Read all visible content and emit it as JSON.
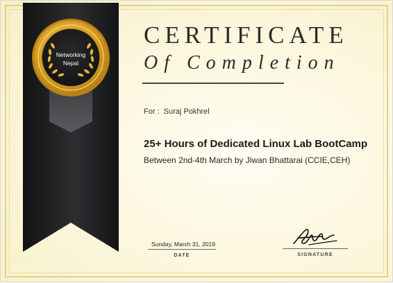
{
  "certificate": {
    "title": "CERTIFICATE",
    "subtitle": "Of Completion",
    "recipient_label": "For :",
    "recipient_name": "Suraj Pokhrel",
    "course": "25+ Hours of Dedicated Linux Lab BootCamp",
    "details": "Between 2nd-4th March by Jiwan Bhattarai (CCIE,CEH)"
  },
  "badge": {
    "line1": "Networking",
    "line2": "Nepal"
  },
  "date": {
    "value": "Sunday, March 31, 2019",
    "label": "DATE"
  },
  "signature": {
    "label": "SIGNATURE"
  },
  "colors": {
    "ribbon": "#1c1c1e",
    "gold": "#d9a527",
    "background": "#fbf6da"
  }
}
